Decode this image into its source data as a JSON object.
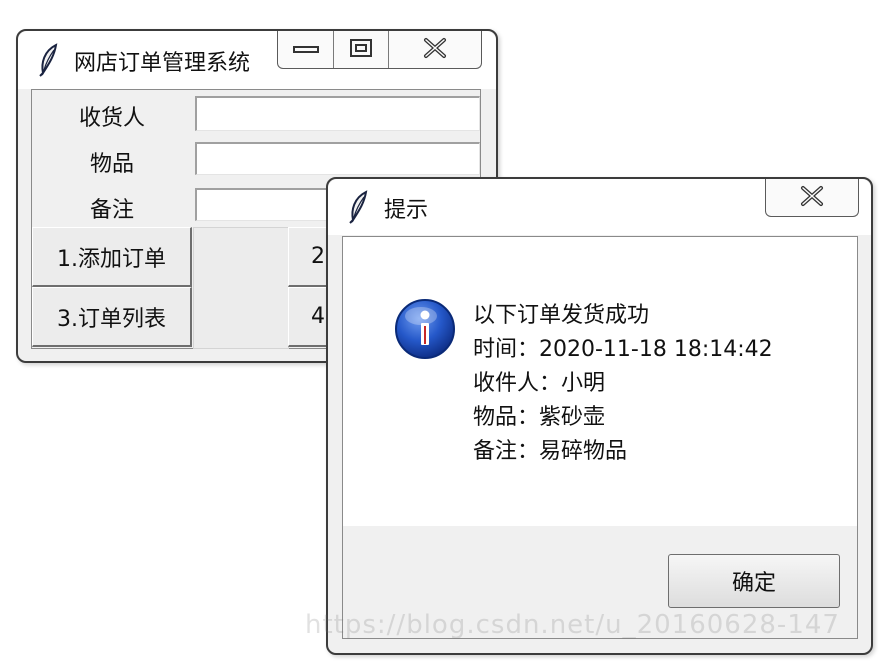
{
  "main_window": {
    "title": "网店订单管理系统",
    "form": {
      "receiver_label": "收货人",
      "item_label": "物品",
      "note_label": "备注",
      "receiver_value": "",
      "item_value": "",
      "note_value": ""
    },
    "buttons": {
      "add_order": "1.添加订单",
      "button_2": "2",
      "order_list": "3.订单列表",
      "button_4": "4"
    }
  },
  "dialog": {
    "title": "提示",
    "icon": "info-icon",
    "message_lines": [
      "以下订单发货成功",
      "时间：2020-11-18 18:14:42",
      "收件人：小明",
      "物品：紫砂壶",
      "备注：易碎物品"
    ],
    "ok_label": "确定"
  },
  "icons": [
    "feather-icon",
    "minimize-icon",
    "maximize-icon",
    "close-icon",
    "info-icon"
  ],
  "colors": {
    "info_blue": "#1f4fbf",
    "window_bg": "#f0f0f0",
    "frame": "#3c3c3c"
  }
}
